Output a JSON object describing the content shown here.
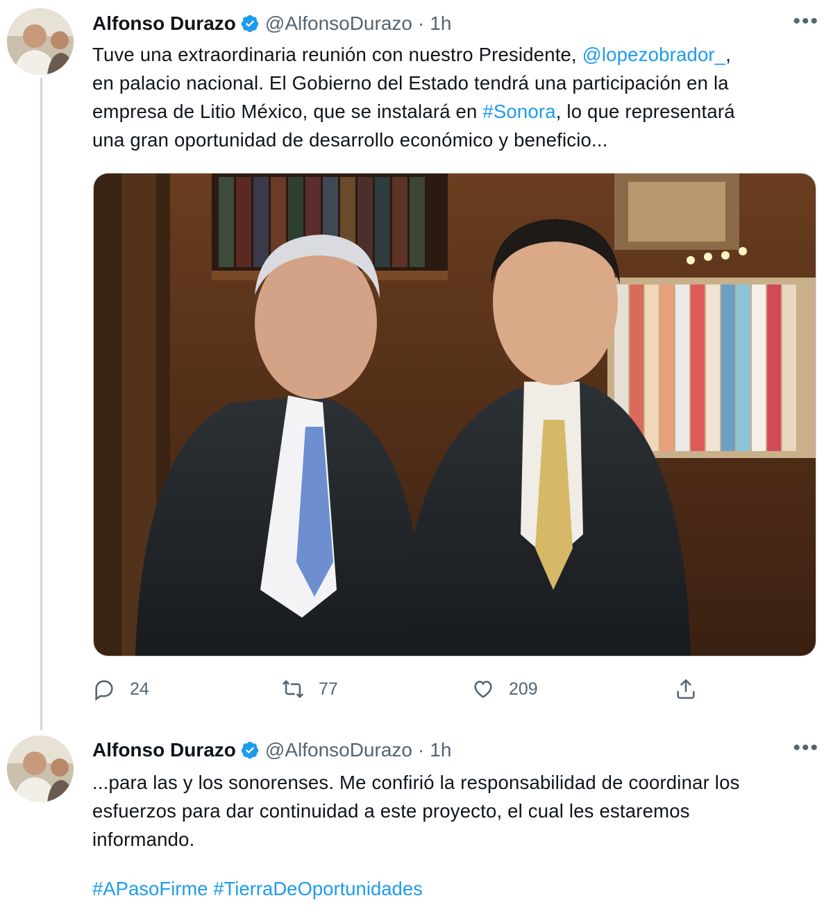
{
  "thread": [
    {
      "author": {
        "name": "Alfonso Durazo",
        "handle": "@AlfonsoDurazo",
        "time": "1h"
      },
      "more_label": "•••",
      "text": {
        "l1_a": "Tuve una extraordinaria reunión con nuestro Presidente, ",
        "l1_mention": "@lopezobrador_",
        "l1_b": ",",
        "l2": "en palacio nacional. El Gobierno del Estado tendrá una participación en la",
        "l3_a": "empresa de Litio México, que se instalará en ",
        "l3_hashtag": "#Sonora",
        "l3_b": ", lo que representará",
        "l4": "una gran oportunidad de desarrollo económico y beneficio..."
      },
      "stats": {
        "replies": "24",
        "retweets": "77",
        "likes": "209"
      }
    },
    {
      "author": {
        "name": "Alfonso Durazo",
        "handle": "@AlfonsoDurazo",
        "time": "1h"
      },
      "more_label": "•••",
      "text": {
        "l1": "...para las y los sonorenses. Me confirió la responsabilidad de coordinar los",
        "l2": "esfuerzos para dar continuidad a este proyecto, el cual les estaremos",
        "l3": "informando."
      },
      "hashtags": [
        "#APasoFirme",
        "#TierraDeOportunidades"
      ]
    }
  ],
  "colors": {
    "link": "#1d9bf0",
    "muted": "#536471",
    "text": "#0f1419",
    "thread_line": "#cfd9de"
  },
  "icons": [
    "verified-badge-icon",
    "more-options-icon",
    "reply-icon",
    "retweet-icon",
    "like-icon",
    "share-icon"
  ]
}
